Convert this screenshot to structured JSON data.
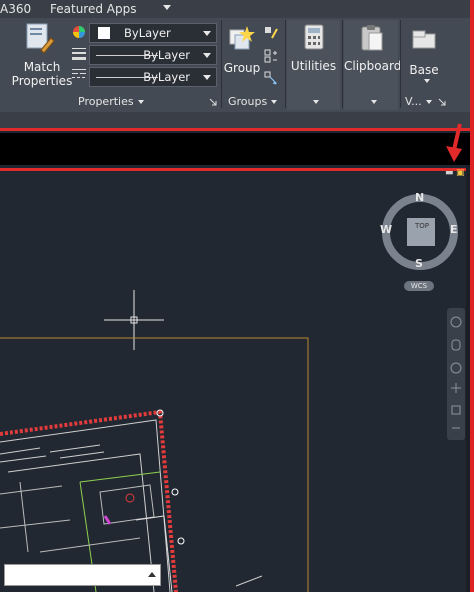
{
  "top_tabs": {
    "a360": "A360",
    "featured_apps": "Featured Apps"
  },
  "ribbon": {
    "match_properties": {
      "line1": "Match",
      "line2": "Properties",
      "icon": "match-properties-icon"
    },
    "layer_combo_1": "ByLayer",
    "layer_combo_2": "ByLayer",
    "layer_combo_3": "ByLayer",
    "properties_panel": "Properties",
    "group_label": "Group",
    "groups_panel": "Groups",
    "utilities_label": "Utilities",
    "clipboard_label": "Clipboard",
    "base_label": "Base",
    "view_panel": "V..."
  },
  "viewcube": {
    "north": "N",
    "south": "S",
    "east": "E",
    "west": "W",
    "top": "TOP",
    "wcs": "WCS"
  },
  "colors": {
    "ribbon_bg": "#444a53",
    "drawing_bg": "#212832",
    "accent_red": "#e12a2a"
  }
}
